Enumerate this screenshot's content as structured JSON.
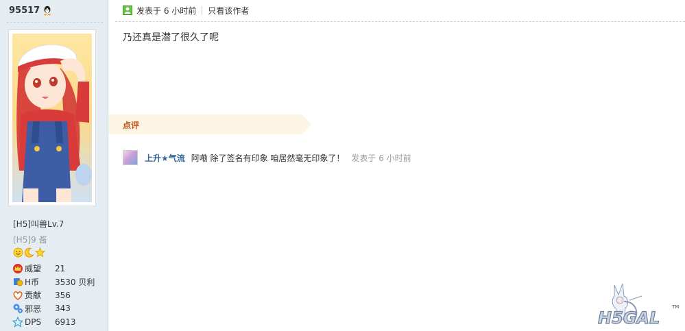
{
  "profile": {
    "uid": "95517",
    "rank": "[H5]叫兽Lv.7",
    "rank_sub": "[H5]9 酱",
    "medals": [
      "smiley-medal-icon",
      "moon-medal-icon",
      "star-medal-icon"
    ],
    "stats": [
      {
        "icon": "crown-icon",
        "label": "威望",
        "value": "21"
      },
      {
        "icon": "coin-icon",
        "label": "H币",
        "value": "3530 贝利"
      },
      {
        "icon": "heart-icon",
        "label": "贡献",
        "value": "356"
      },
      {
        "icon": "gear-icon",
        "label": "邪恶",
        "value": "343"
      },
      {
        "icon": "star-icon",
        "label": "DPS",
        "value": "6913"
      }
    ]
  },
  "post": {
    "time_label": "发表于 6 小时前",
    "only_author_label": "只看该作者",
    "content": "乃还真是潜了很久了呢"
  },
  "comments_section": {
    "title": "点评",
    "items": [
      {
        "author": "上升★气流",
        "text": "阿嘞 除了签名有印象 咱居然毫无印象了！",
        "time": "发表于 6 小时前"
      }
    ]
  },
  "watermark": {
    "text": "H5GAL",
    "tm": "TM"
  },
  "colors": {
    "sidebar_bg": "#e5edf2",
    "comment_tab_bg": "#fdf5e3",
    "comment_tab_text": "#c3571f",
    "author_link": "#336699"
  }
}
